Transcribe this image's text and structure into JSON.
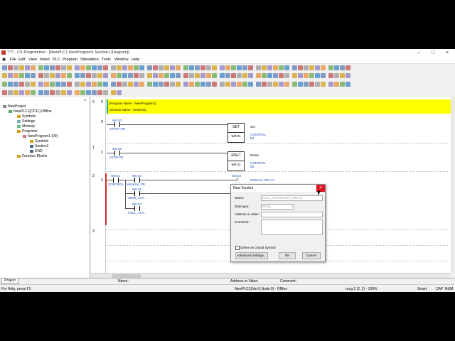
{
  "window": {
    "title": "??? - CX-Programmer - [NewPLC1.NewProgram1.Section1 [Diagram]]"
  },
  "menu": [
    "File",
    "Edit",
    "View",
    "Insert",
    "PLC",
    "Program",
    "Simulation",
    "Tools",
    "Window",
    "Help"
  ],
  "project_tree": {
    "root": "NewProject",
    "plc": "NewPLC1[CP1L] Offline",
    "items": [
      "Symbols",
      "Settings",
      "Memory",
      "Programs",
      "NewProgram1 (00)",
      "Symbols",
      "Section1",
      "END",
      "Function Blocks"
    ]
  },
  "ladder": {
    "header_program": "[Program Name : NewProgram1]",
    "header_section": "[Section Name : Section1]",
    "rungs": [
      {
        "num": "0",
        "step": "0",
        "contact_addr": "W0.00",
        "contact_name": "START PB",
        "fn": "SET",
        "fn_arg": "W0.01",
        "out_comment": "Set",
        "out_name": "CONTROL",
        "out_type": "Bit"
      },
      {
        "num": "1",
        "step": "2",
        "contact_addr": "W0.02",
        "contact_name": "STOP PB",
        "fn": "RSET",
        "fn_arg": "W0.01",
        "out_comment": "Reset",
        "out_name": "CONTROL",
        "out_type": "Bit"
      },
      {
        "num": "2",
        "step": "4",
        "c1_addr": "W0.01",
        "c1_name": "CONTROL",
        "c2_addr": "W0.03",
        "c2_name": "MANUAL PB",
        "c3_addr": "W0.05",
        "c3_name": "SEMI_AUT...",
        "c4_addr": "W0.07",
        "c4_name": "FULL_AUT...",
        "coil_addr": "W0.04",
        "coil_name": "MANUAL RELAY"
      },
      {
        "num": "3",
        "step": ""
      }
    ]
  },
  "dialog": {
    "title": "New Symbol",
    "name_label": "Name:",
    "name_value": "FULL_AUTOMATIC_RELAY",
    "datatype_label": "Data type:",
    "datatype_value": "BOOL",
    "address_label": "Address or value:",
    "comment_label": "Comment:",
    "global_label": "Define as Global Symbol",
    "advanced_button": "Advanced Settings...",
    "ok_button": "OK",
    "cancel_button": "Cancel"
  },
  "tabs": {
    "project": "Project",
    "name_col": "Name:",
    "address_col": "Address or Value:",
    "comment_col": "Comment:"
  },
  "status": {
    "help": "For Help, press F1",
    "plc": "NewPLC1(Net:0,Node:0) - Offline",
    "position": "rung 2 (2, 2) - 100%",
    "mode": "Smart",
    "caps": "CAP",
    "num": "NUM"
  }
}
